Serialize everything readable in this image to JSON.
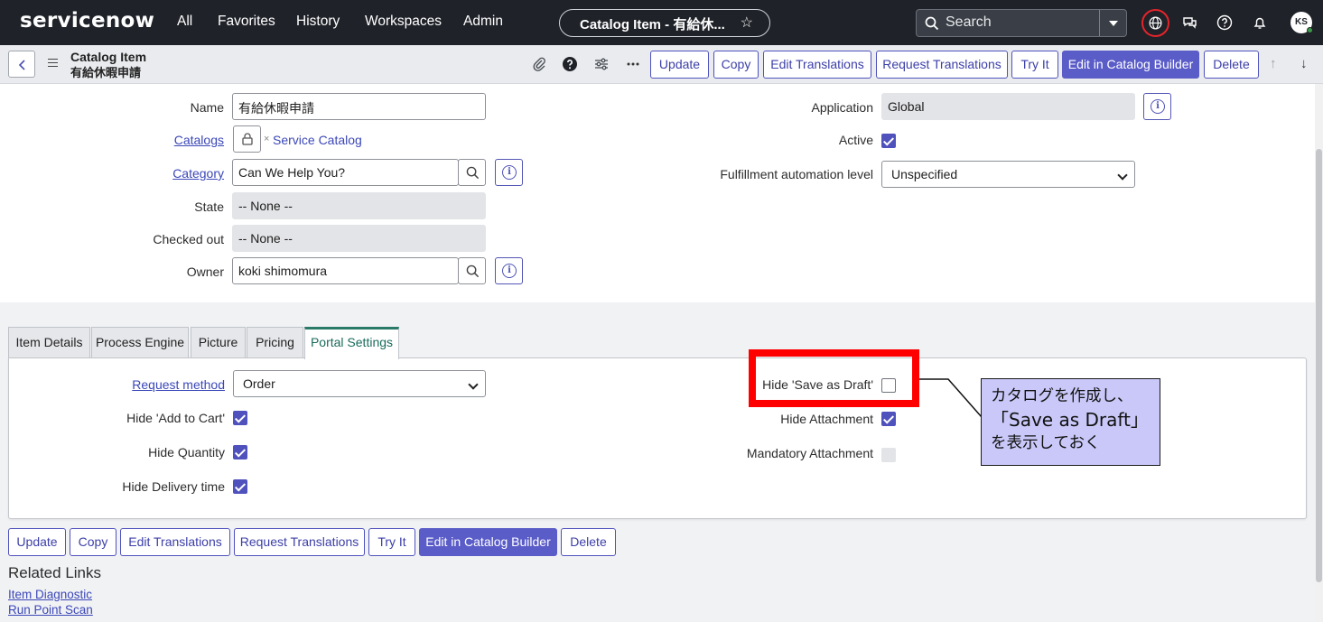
{
  "nav": {
    "logo": "servicenow",
    "items": [
      "All",
      "Favorites",
      "History",
      "Workspaces",
      "Admin"
    ],
    "context_pill": "Catalog Item - 有給休...",
    "search_placeholder": "Search",
    "avatar_initials": "KS"
  },
  "header": {
    "record_type": "Catalog Item",
    "record_name": "有給休暇申請",
    "buttons": {
      "update": "Update",
      "copy": "Copy",
      "edit_translations": "Edit Translations",
      "request_translations": "Request Translations",
      "try_it": "Try It",
      "edit_catalog_builder": "Edit in Catalog Builder",
      "delete": "Delete"
    }
  },
  "form": {
    "name": {
      "label": "Name",
      "value": "有給休暇申請"
    },
    "catalogs": {
      "label": "Catalogs",
      "value": "Service Catalog",
      "remove_glyph": "×"
    },
    "category": {
      "label": "Category",
      "value": "Can We Help You?"
    },
    "state": {
      "label": "State",
      "value": "-- None --"
    },
    "checked_out": {
      "label": "Checked out",
      "value": "-- None --"
    },
    "owner": {
      "label": "Owner",
      "value": "koki shimomura"
    },
    "application": {
      "label": "Application",
      "value": "Global"
    },
    "active": {
      "label": "Active",
      "checked": true
    },
    "fulfillment": {
      "label": "Fulfillment automation level",
      "value": "Unspecified"
    }
  },
  "tabs": [
    "Item Details",
    "Process Engine",
    "Picture",
    "Pricing",
    "Portal Settings"
  ],
  "active_tab": "Portal Settings",
  "portal": {
    "request_method": {
      "label": "Request method",
      "value": "Order"
    },
    "hide_add_to_cart": {
      "label": "Hide 'Add to Cart'",
      "checked": true
    },
    "hide_quantity": {
      "label": "Hide Quantity",
      "checked": true
    },
    "hide_delivery_time": {
      "label": "Hide Delivery time",
      "checked": true
    },
    "hide_save_as_draft": {
      "label": "Hide 'Save as Draft'",
      "checked": false
    },
    "hide_attachment": {
      "label": "Hide Attachment",
      "checked": true
    },
    "mandatory_attachment": {
      "label": "Mandatory Attachment",
      "checked": false
    }
  },
  "callout": {
    "line1": "カタログを作成し、",
    "line2": "「Save as Draft」",
    "line3": "を表示しておく"
  },
  "related": {
    "title": "Related Links",
    "links": [
      "Item Diagnostic",
      "Run Point Scan"
    ]
  },
  "colors": {
    "nav_bg": "#1f2228",
    "primary": "#5a5cc8",
    "highlight_red": "#ff0000",
    "callout_bg": "#c9c8f8",
    "active_tab": "#2a7a68"
  }
}
